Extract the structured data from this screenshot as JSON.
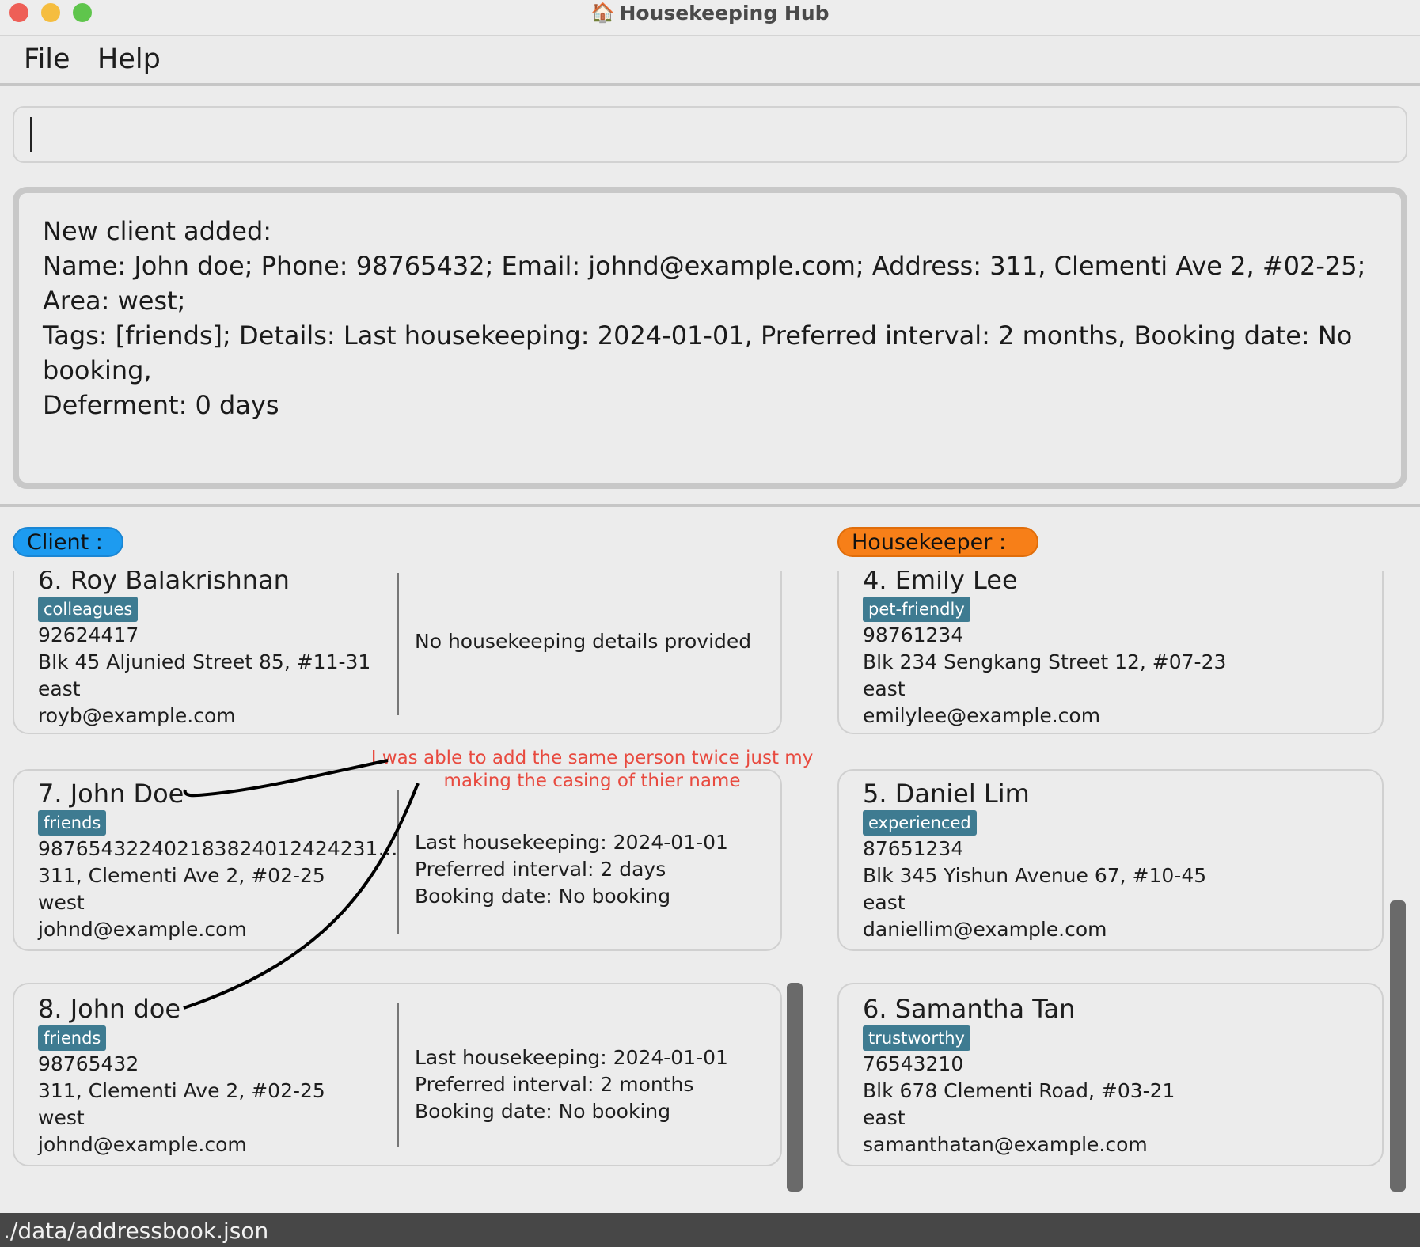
{
  "window": {
    "title": "Housekeeping Hub",
    "app_icon": "house-icon"
  },
  "menu": {
    "file": "File",
    "help": "Help"
  },
  "command": {
    "value": ""
  },
  "result": {
    "text": "New client added:\nName: John doe; Phone: 98765432; Email: johnd@example.com; Address: 311, Clementi Ave 2, #02-25; Area: west;\nTags: [friends]; Details: Last housekeeping: 2024-01-01, Preferred interval: 2 months, Booking date: No booking,\nDeferment: 0 days"
  },
  "client_panel": {
    "label": "Client :",
    "cards": [
      {
        "name": "6.  Roy Balakrishnan",
        "tag": "colleagues",
        "phone": "92624417",
        "address": "Blk 45 Aljunied Street 85, #11-31",
        "area": "east",
        "email": "royb@example.com",
        "details": [
          "No housekeeping details provided"
        ]
      },
      {
        "name": "7.  John Doe",
        "tag": "friends",
        "phone": "987654322402183824012424231…",
        "address": "311, Clementi Ave 2, #02-25",
        "area": "west",
        "email": "johnd@example.com",
        "details": [
          "Last housekeeping: 2024-01-01",
          "Preferred interval: 2 days",
          "Booking date: No booking"
        ]
      },
      {
        "name": "8.  John doe",
        "tag": "friends",
        "phone": "98765432",
        "address": "311, Clementi Ave 2, #02-25",
        "area": "west",
        "email": "johnd@example.com",
        "details": [
          "Last housekeeping: 2024-01-01",
          "Preferred interval: 2 months",
          "Booking date: No booking"
        ]
      }
    ]
  },
  "housekeeper_panel": {
    "label": "Housekeeper :",
    "cards": [
      {
        "name": "4.  Emily Lee",
        "tag": "pet-friendly",
        "phone": "98761234",
        "address": "Blk 234 Sengkang Street 12, #07-23",
        "area": "east",
        "email": "emilylee@example.com"
      },
      {
        "name": "5.  Daniel Lim",
        "tag": "experienced",
        "phone": "87651234",
        "address": "Blk 345 Yishun Avenue 67, #10-45",
        "area": "east",
        "email": "daniellim@example.com"
      },
      {
        "name": "6.  Samantha Tan",
        "tag": "trustworthy",
        "phone": "76543210",
        "address": "Blk 678 Clementi Road, #03-21",
        "area": "east",
        "email": "samanthatan@example.com"
      }
    ]
  },
  "annotation": {
    "text": "I was able to add the same person twice just my making the casing of thier name",
    "color": "#e84a3f"
  },
  "status": {
    "path": "./data/addressbook.json"
  },
  "colors": {
    "client_pill": "#1d9bf0",
    "housekeeper_pill": "#f77f18",
    "tag": "#3e7b91"
  }
}
